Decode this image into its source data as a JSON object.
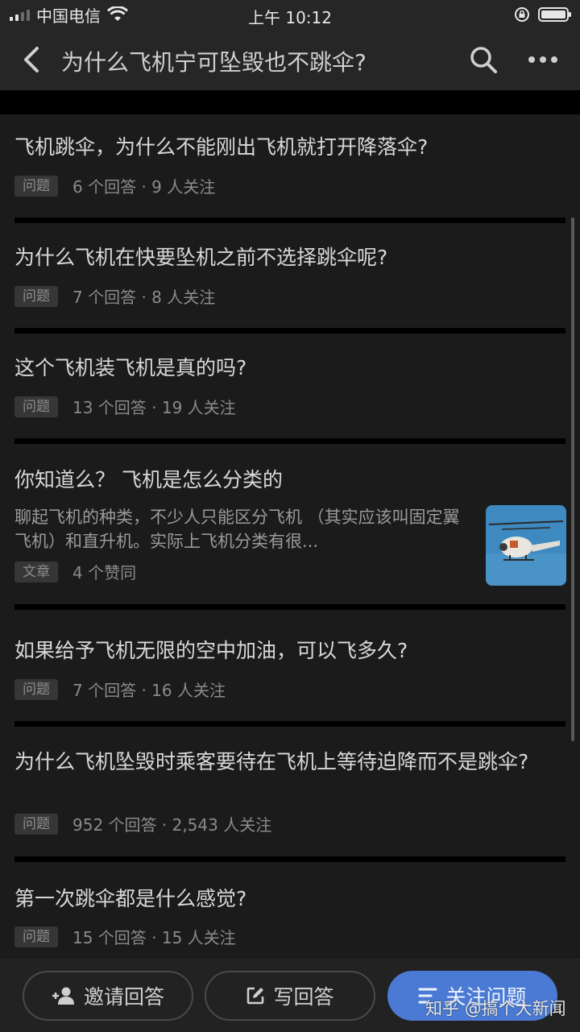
{
  "status_bar": {
    "carrier": "中国电信",
    "time": "上午 10:12"
  },
  "nav": {
    "title": "为什么飞机宁可坠毁也不跳伞?"
  },
  "items": [
    {
      "title": "飞机跳伞，为什么不能刚出飞机就打开降落伞?",
      "tag": "问题",
      "stats": "6 个回答 · 9 人关注"
    },
    {
      "title": "为什么飞机在快要坠机之前不选择跳伞呢?",
      "tag": "问题",
      "stats": "7 个回答 · 8 人关注"
    },
    {
      "title": "这个飞机装飞机是真的吗?",
      "tag": "问题",
      "stats": "13 个回答 · 19 人关注"
    },
    {
      "title": "你知道么？ 飞机是怎么分类的",
      "excerpt": "聊起飞机的种类，不少人只能区分飞机 （其实应该叫固定翼飞机）和直升机。实际上飞机分类有很...",
      "tag": "文章",
      "stats": "4 个赞同"
    },
    {
      "title": "如果给予飞机无限的空中加油，可以飞多久?",
      "tag": "问题",
      "stats": "7 个回答 · 16 人关注"
    },
    {
      "title": "为什么飞机坠毁时乘客要待在飞机上等待迫降而不是跳伞?",
      "tag": "问题",
      "stats": "952 个回答 · 2,543 人关注"
    },
    {
      "title": "第一次跳伞都是什么感觉?",
      "tag": "问题",
      "stats": "15 个回答 · 15 人关注"
    }
  ],
  "bottom_bar": {
    "invite_label": "邀请回答",
    "write_label": "写回答",
    "follow_label": "关注问题"
  },
  "watermark": "知乎 @搞个大新闻",
  "colors": {
    "background": "#1b1b1b",
    "separator": "#000000",
    "primary_button": "#4a7ad3",
    "tag_background": "#363636"
  },
  "icons": [
    "back-icon",
    "search-icon",
    "more-icon",
    "wifi-icon",
    "lock-rotation-icon",
    "battery-icon",
    "add-user-icon",
    "edit-icon",
    "list-icon"
  ]
}
